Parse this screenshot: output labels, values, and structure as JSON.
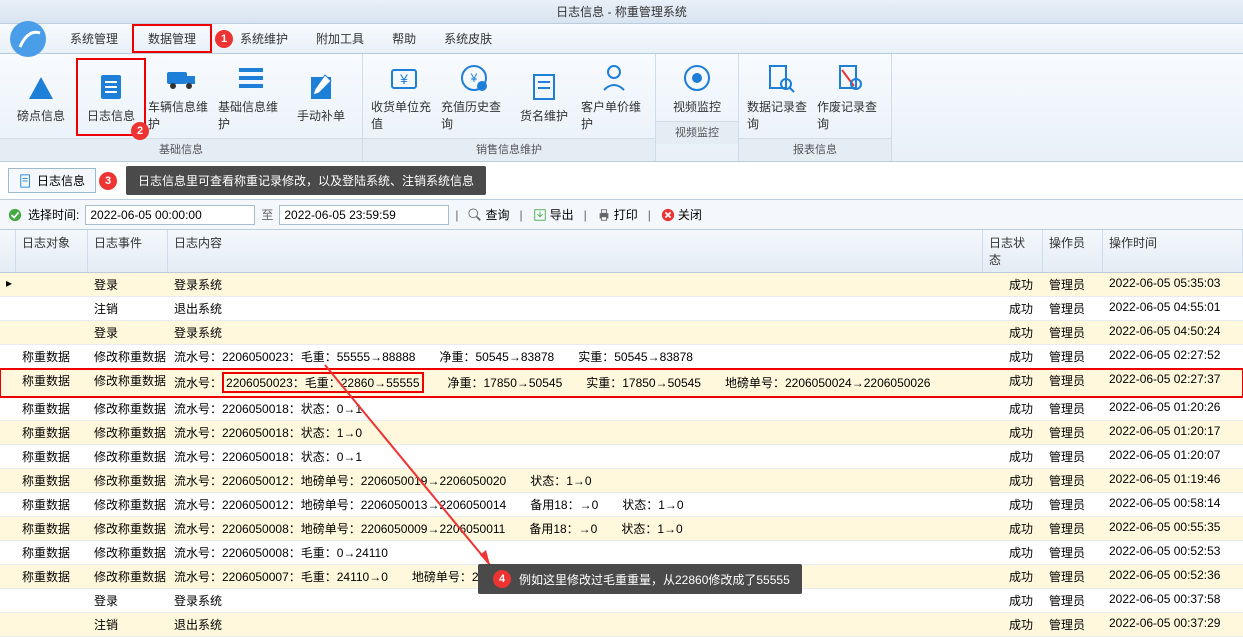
{
  "title": "日志信息 - 称重管理系统",
  "menu": [
    "系统管理",
    "数据管理",
    "系统维护",
    "附加工具",
    "帮助",
    "系统皮肤"
  ],
  "ribbon": {
    "basic": {
      "label": "基础信息",
      "items": [
        {
          "k": "磅点信息",
          "icon": "home"
        },
        {
          "k": "日志信息",
          "icon": "clipboard"
        },
        {
          "k": "车辆信息维护",
          "icon": "truck"
        },
        {
          "k": "基础信息维护",
          "icon": "list"
        },
        {
          "k": "手动补单",
          "icon": "edit"
        }
      ]
    },
    "sales": {
      "label": "销售信息维护",
      "items": [
        {
          "k": "收货单位充值",
          "icon": "money"
        },
        {
          "k": "充值历史查询",
          "icon": "history"
        },
        {
          "k": "货名维护",
          "icon": "doc"
        },
        {
          "k": "客户单价维护",
          "icon": "user"
        }
      ]
    },
    "video": {
      "label": "视频监控",
      "items": [
        {
          "k": "视频监控",
          "icon": "camera"
        }
      ]
    },
    "report": {
      "label": "报表信息",
      "items": [
        {
          "k": "数据记录查询",
          "icon": "search-doc"
        },
        {
          "k": "作废记录查询",
          "icon": "void-doc"
        }
      ]
    }
  },
  "tab": {
    "name": "日志信息"
  },
  "tooltip1": "日志信息里可查看称重记录修改，以及登陆系统、注销系统信息",
  "toolbar": {
    "time_label": "选择时间:",
    "start": "2022-06-05 00:00:00",
    "to": "至",
    "end": "2022-06-05 23:59:59",
    "query": "查询",
    "export": "导出",
    "print": "打印",
    "close": "关闭"
  },
  "headers": {
    "obj": "日志对象",
    "evt": "日志事件",
    "content": "日志内容",
    "status": "日志状态",
    "operator": "操作员",
    "time": "操作时间"
  },
  "rows": [
    {
      "obj": "",
      "evt": "登录",
      "content": "登录系统",
      "status": "成功",
      "op": "管理员",
      "time": "2022-06-05 05:35:03",
      "alt": true
    },
    {
      "obj": "",
      "evt": "注销",
      "content": "退出系统",
      "status": "成功",
      "op": "管理员",
      "time": "2022-06-05 04:55:01",
      "alt": false
    },
    {
      "obj": "",
      "evt": "登录",
      "content": "登录系统",
      "status": "成功",
      "op": "管理员",
      "time": "2022-06-05 04:50:24",
      "alt": true
    },
    {
      "obj": "称重数据",
      "evt": "修改称重数据",
      "content": "流水号：2206050023：毛重：55555→88888　　净重：50545→83878　　实重：50545→83878",
      "status": "成功",
      "op": "管理员",
      "time": "2022-06-05 02:27:52",
      "alt": false
    },
    {
      "obj": "称重数据",
      "evt": "修改称重数据",
      "content": "",
      "status": "成功",
      "op": "管理员",
      "time": "2022-06-05 02:27:37",
      "alt": true,
      "special": true,
      "pre": "流水号：",
      "box": "2206050023：毛重：22860→55555",
      "post": "　　净重：17850→50545　　实重：17850→50545　　地磅单号：2206050024→2206050026"
    },
    {
      "obj": "称重数据",
      "evt": "修改称重数据",
      "content": "流水号：2206050018：状态：0→1",
      "status": "成功",
      "op": "管理员",
      "time": "2022-06-05 01:20:26",
      "alt": false
    },
    {
      "obj": "称重数据",
      "evt": "修改称重数据",
      "content": "流水号：2206050018：状态：1→0",
      "status": "成功",
      "op": "管理员",
      "time": "2022-06-05 01:20:17",
      "alt": true
    },
    {
      "obj": "称重数据",
      "evt": "修改称重数据",
      "content": "流水号：2206050018：状态：0→1",
      "status": "成功",
      "op": "管理员",
      "time": "2022-06-05 01:20:07",
      "alt": false
    },
    {
      "obj": "称重数据",
      "evt": "修改称重数据",
      "content": "流水号：2206050012：地磅单号：2206050019→2206050020　　状态：1→0",
      "status": "成功",
      "op": "管理员",
      "time": "2022-06-05 01:19:46",
      "alt": true
    },
    {
      "obj": "称重数据",
      "evt": "修改称重数据",
      "content": "流水号：2206050012：地磅单号：2206050013→2206050014　　备用18：→0　　状态：1→0",
      "status": "成功",
      "op": "管理员",
      "time": "2022-06-05 00:58:14",
      "alt": false
    },
    {
      "obj": "称重数据",
      "evt": "修改称重数据",
      "content": "流水号：2206050008：地磅单号：2206050009→2206050011　　备用18：→0　　状态：1→0",
      "status": "成功",
      "op": "管理员",
      "time": "2022-06-05 00:55:35",
      "alt": true
    },
    {
      "obj": "称重数据",
      "evt": "修改称重数据",
      "content": "流水号：2206050008：毛重：0→24110",
      "status": "成功",
      "op": "管理员",
      "time": "2022-06-05 00:52:53",
      "alt": false
    },
    {
      "obj": "称重数据",
      "evt": "修改称重数据",
      "content": "流水号：2206050007：毛重：24110→0　　地磅单号：2206050008→2206050009　　备用18：→0　　状态：1→0",
      "status": "成功",
      "op": "管理员",
      "time": "2022-06-05 00:52:36",
      "alt": true
    },
    {
      "obj": "",
      "evt": "登录",
      "content": "登录系统",
      "status": "成功",
      "op": "管理员",
      "time": "2022-06-05 00:37:58",
      "alt": false
    },
    {
      "obj": "",
      "evt": "注销",
      "content": "退出系统",
      "status": "成功",
      "op": "管理员",
      "time": "2022-06-05 00:37:29",
      "alt": true
    }
  ],
  "callout4": "例如这里修改过毛重重量，从22860修改成了55555"
}
